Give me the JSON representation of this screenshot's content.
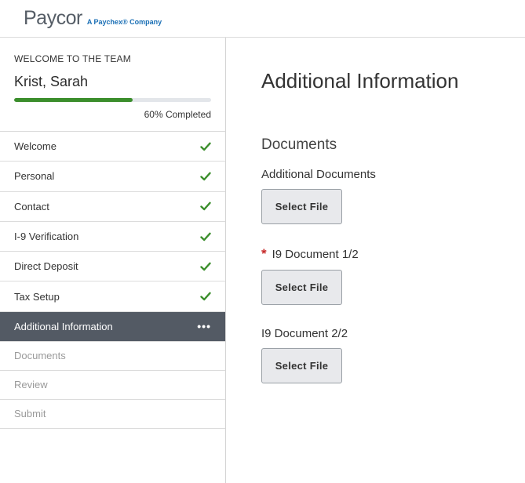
{
  "header": {
    "logo_text": "Paycor",
    "logo_subtitle": "A Paychex® Company"
  },
  "sidebar": {
    "welcome_label": "WELCOME TO THE TEAM",
    "employee_name": "Krist, Sarah",
    "progress_percent": 60,
    "progress_text": "60% Completed",
    "items": [
      {
        "label": "Welcome",
        "status": "complete",
        "icon": "check-icon"
      },
      {
        "label": "Personal",
        "status": "complete",
        "icon": "check-icon"
      },
      {
        "label": "Contact",
        "status": "complete",
        "icon": "check-icon"
      },
      {
        "label": "I-9 Verification",
        "status": "complete",
        "icon": "check-icon"
      },
      {
        "label": "Direct Deposit",
        "status": "complete",
        "icon": "check-icon"
      },
      {
        "label": "Tax Setup",
        "status": "complete",
        "icon": "check-icon"
      },
      {
        "label": "Additional Information",
        "status": "active",
        "icon": "more-dots-icon"
      },
      {
        "label": "Documents",
        "status": "pending"
      },
      {
        "label": "Review",
        "status": "pending"
      },
      {
        "label": "Submit",
        "status": "pending"
      }
    ],
    "colors": {
      "check": "#3b8e2c",
      "active_bg": "#535a64",
      "progress": "#3b8e2c"
    }
  },
  "main": {
    "page_title": "Additional Information",
    "section_title": "Documents",
    "fields": [
      {
        "label": "Additional Documents",
        "required": false,
        "button_label": "Select File"
      },
      {
        "label": "I9 Document 1/2",
        "required": true,
        "required_mark": "*",
        "button_label": "Select File"
      },
      {
        "label": "I9 Document 2/2",
        "required": false,
        "button_label": "Select File"
      }
    ]
  }
}
